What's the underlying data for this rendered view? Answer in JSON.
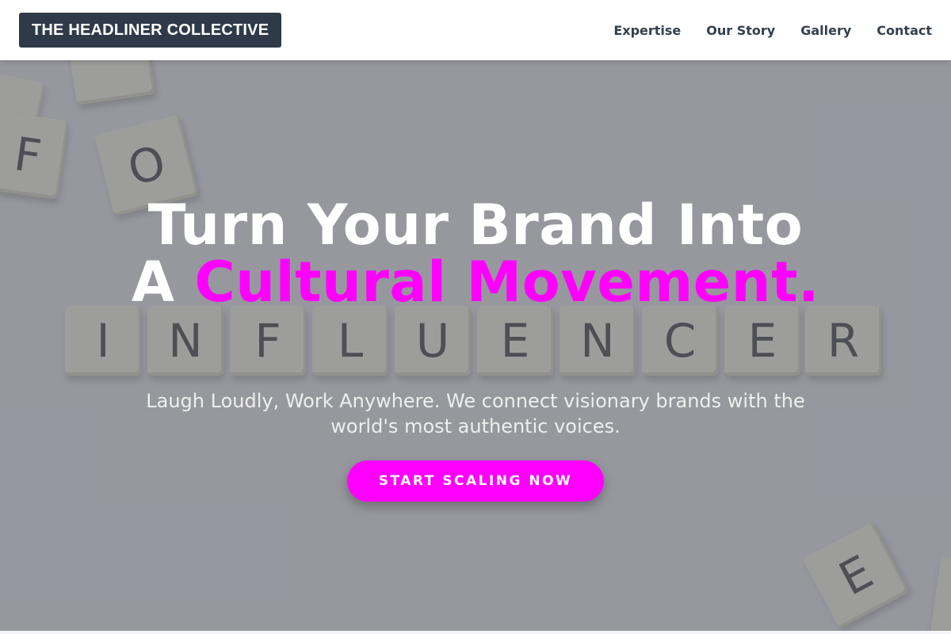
{
  "header": {
    "logo": "THE HEADLINER COLLECTIVE",
    "nav": [
      {
        "label": "Expertise"
      },
      {
        "label": "Our Story"
      },
      {
        "label": "Gallery"
      },
      {
        "label": "Contact"
      }
    ]
  },
  "hero": {
    "headline_prefix": "Turn Your Brand Into A ",
    "headline_accent": "Cultural Movement.",
    "subtitle": "Laugh Loudly, Work Anywhere. We connect visionary brands with the world's most authentic voices.",
    "cta_label": "START SCALING NOW",
    "background_tiles": [
      "F",
      "O",
      "I",
      "N",
      "F",
      "L",
      "U",
      "E",
      "N",
      "C",
      "E",
      "R",
      "E"
    ]
  },
  "colors": {
    "accent": "#ff00ff",
    "logo_bg": "#2f3a48",
    "nav_text": "#33404e"
  }
}
